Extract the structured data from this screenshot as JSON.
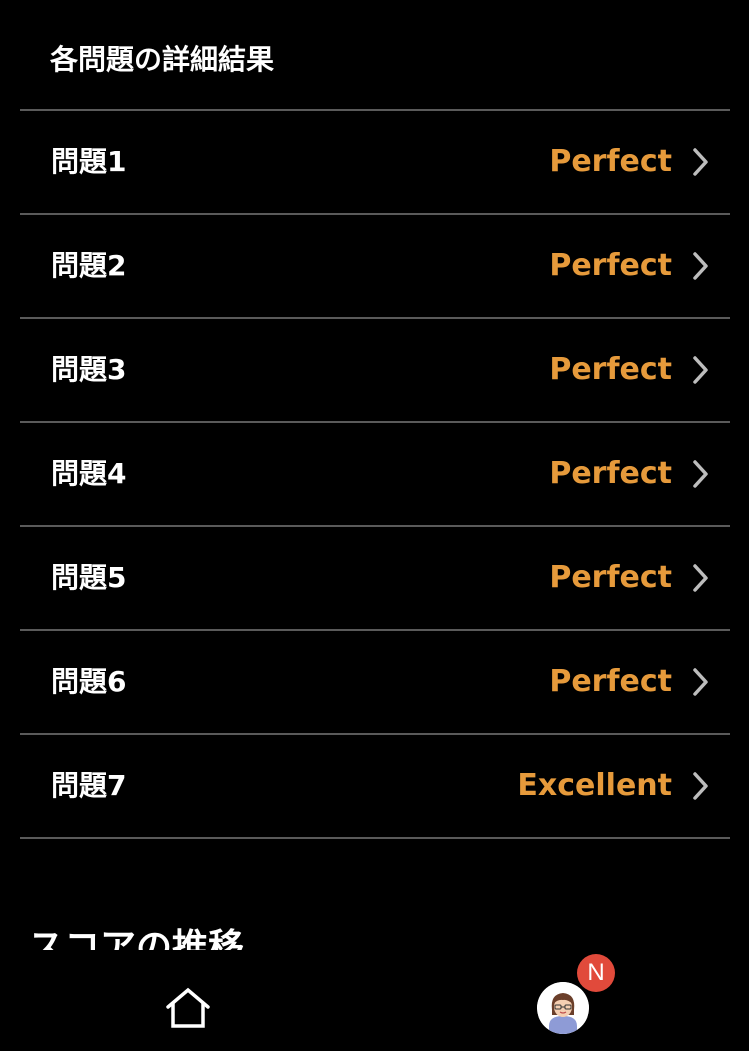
{
  "section": {
    "title": "各問題の詳細結果"
  },
  "problems": [
    {
      "label": "問題1",
      "result": "Perfect"
    },
    {
      "label": "問題2",
      "result": "Perfect"
    },
    {
      "label": "問題3",
      "result": "Perfect"
    },
    {
      "label": "問題4",
      "result": "Perfect"
    },
    {
      "label": "問題5",
      "result": "Perfect"
    },
    {
      "label": "問題6",
      "result": "Perfect"
    },
    {
      "label": "問題7",
      "result": "Excellent"
    }
  ],
  "next_section": {
    "title": "スコアの推移"
  },
  "bottom_nav": {
    "home_icon": "home-icon",
    "avatar_icon": "user-avatar-icon",
    "badge_text": "N"
  },
  "colors": {
    "background": "#000000",
    "divider": "#5a5a5a",
    "result_accent": "#e69a3b",
    "badge": "#e14a3b"
  }
}
